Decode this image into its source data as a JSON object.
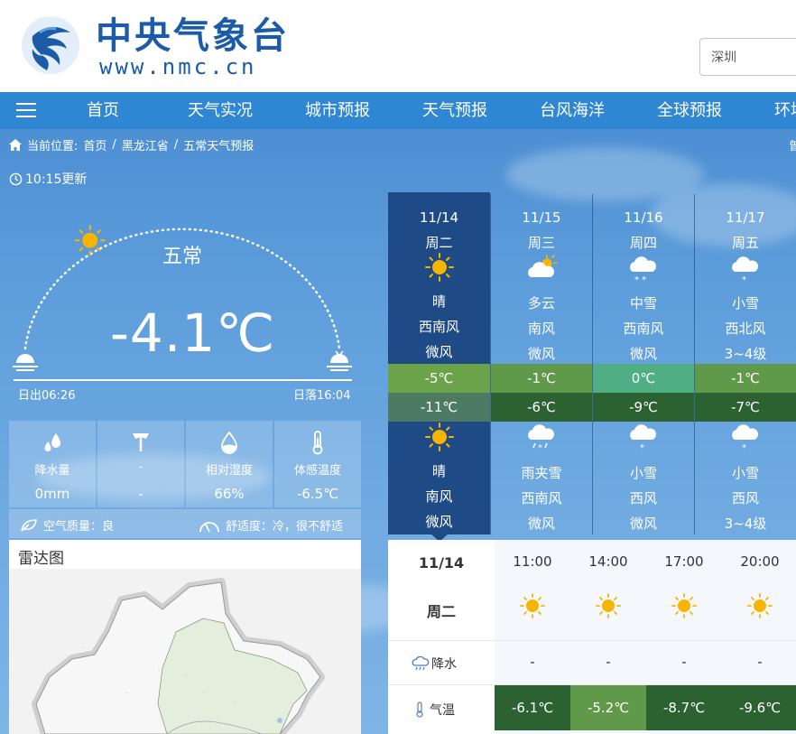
{
  "header": {
    "site_title": "中央气象台",
    "site_url": "www.nmc.cn",
    "search_value": "深圳"
  },
  "nav": {
    "items": [
      "首页",
      "天气实况",
      "城市预报",
      "天气预报",
      "台风海洋",
      "全球预报",
      "环境"
    ]
  },
  "breadcrumb": {
    "label": "当前位置:",
    "items": [
      "首页",
      "黑龙江省",
      "五常天气预报"
    ],
    "right_cut": "曾"
  },
  "current": {
    "update_time": "10:15更新",
    "city": "五常",
    "temperature": "-4.1℃",
    "sunrise": "日出06:26",
    "sunset": "日落16:04",
    "sun_position_fraction": 0.3,
    "stats": [
      {
        "icon": "raindrops-icon",
        "label": "降水量",
        "value": "0mm"
      },
      {
        "icon": "wind-vane-icon",
        "label": "-",
        "value": "-"
      },
      {
        "icon": "humidity-drop-icon",
        "label": "相对湿度",
        "value": "66%"
      },
      {
        "icon": "thermometer-icon",
        "label": "体感温度",
        "value": "-6.5℃"
      }
    ],
    "air_quality": "空气质量：良",
    "comfort": "舒适度：冷，很不舒适"
  },
  "radar": {
    "title": "雷达图"
  },
  "forecast": [
    {
      "date": "11/14",
      "weekday": "周二",
      "day_icon": "sunny-icon",
      "day_weather": "晴",
      "day_wind_dir": "西南风",
      "day_wind_force": "微风",
      "high": "-5℃",
      "low": "-11℃",
      "night_icon": "sunny-icon",
      "night_weather": "晴",
      "night_wind_dir": "南风",
      "night_wind_force": "微风",
      "high_color": "#6aa34a",
      "low_color": "#4d7a62",
      "selected": true
    },
    {
      "date": "11/15",
      "weekday": "周三",
      "day_icon": "partly-cloudy-icon",
      "day_weather": "多云",
      "day_wind_dir": "南风",
      "day_wind_force": "微风",
      "high": "-1℃",
      "low": "-6℃",
      "night_icon": "sleet-icon",
      "night_weather": "雨夹雪",
      "night_wind_dir": "西南风",
      "night_wind_force": "微风",
      "high_color": "#61994a",
      "low_color": "#2c6232",
      "selected": false
    },
    {
      "date": "11/16",
      "weekday": "周四",
      "day_icon": "moderate-snow-icon",
      "day_weather": "中雪",
      "day_wind_dir": "西南风",
      "day_wind_force": "微风",
      "high": "0℃",
      "low": "-9℃",
      "night_icon": "light-snow-icon",
      "night_weather": "小雪",
      "night_wind_dir": "西风",
      "night_wind_force": "微风",
      "high_color": "#4fae84",
      "low_color": "#2c6232",
      "selected": false
    },
    {
      "date": "11/17",
      "weekday": "周五",
      "day_icon": "light-snow-icon",
      "day_weather": "小雪",
      "day_wind_dir": "西北风",
      "day_wind_force": "3~4级",
      "high": "-1℃",
      "low": "-7℃",
      "night_icon": "light-snow-icon",
      "night_weather": "小雪",
      "night_wind_dir": "西风",
      "night_wind_force": "3~4级",
      "high_color": "#61994a",
      "low_color": "#2c6232",
      "selected": false
    }
  ],
  "hourly": {
    "date": "11/14",
    "weekday": "周二",
    "precip_label": "降水",
    "temp_label": "气温",
    "times": [
      "11:00",
      "14:00",
      "17:00",
      "20:00"
    ],
    "precip": [
      "-",
      "-",
      "-",
      "-"
    ],
    "temps": [
      "-6.1℃",
      "-5.2℃",
      "-8.7℃",
      "-9.6℃"
    ],
    "temp_colors": [
      "#2c6232",
      "#61994a",
      "#2c6232",
      "#2c6232"
    ]
  },
  "colors": {
    "nav_bg": "#2f86d2",
    "logo_blue": "#1c5ba8",
    "selected_day_bg": "#1e4a86"
  }
}
